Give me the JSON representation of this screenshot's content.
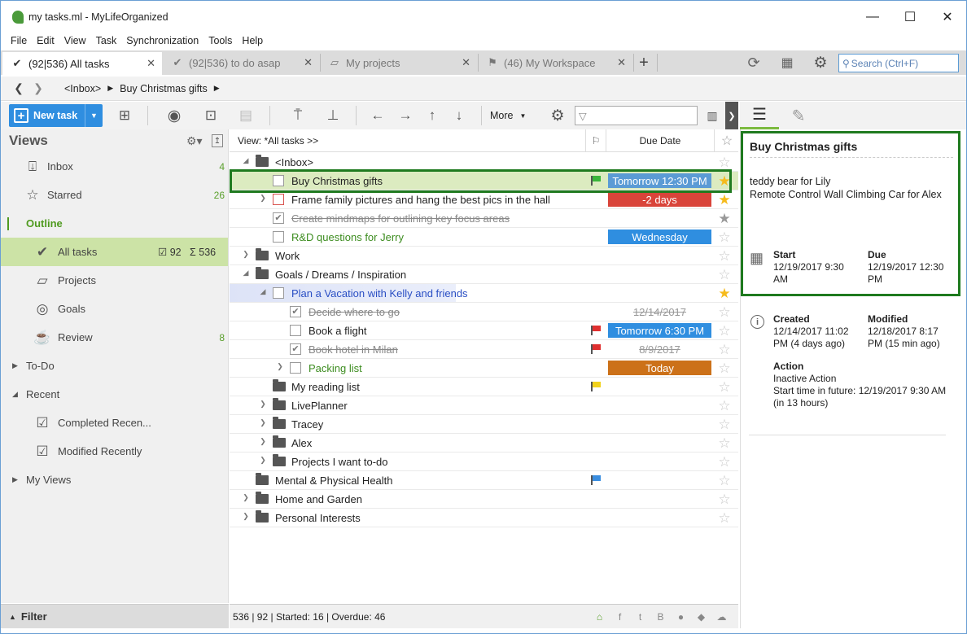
{
  "window": {
    "title": "my tasks.ml - MyLifeOrganized",
    "controls": [
      "—",
      "☐",
      "✕"
    ]
  },
  "menu": [
    "File",
    "Edit",
    "View",
    "Task",
    "Synchronization",
    "Tools",
    "Help"
  ],
  "tabs": [
    {
      "label": "(92|536) All tasks",
      "icon": "tasks-check-icon",
      "active": true
    },
    {
      "label": "(92|536) to do asap",
      "icon": "tasks-check-icon",
      "active": false
    },
    {
      "label": "My projects",
      "icon": "projects-icon",
      "active": false
    },
    {
      "label": "(46) My Workspace",
      "icon": "workspace-flag-icon",
      "active": false
    }
  ],
  "search": {
    "placeholder": "Search (Ctrl+F)"
  },
  "breadcrumb": {
    "items": [
      "<Inbox>",
      "Buy Christmas gifts"
    ]
  },
  "toolbar": {
    "new_task": "New task",
    "more": "More"
  },
  "sidebar": {
    "title": "Views",
    "items": [
      {
        "label": "Inbox",
        "count": "4",
        "icon": "inbox-icon"
      },
      {
        "label": "Starred",
        "count": "26",
        "icon": "star-icon"
      },
      {
        "label": "Outline"
      },
      {
        "label": "All tasks",
        "check_count": "92",
        "sigma_count": "536",
        "icon": "all-tasks-icon"
      },
      {
        "label": "Projects",
        "icon": "projects-icon"
      },
      {
        "label": "Goals",
        "icon": "goals-target-icon"
      },
      {
        "label": "Review",
        "count": "8",
        "icon": "review-coffee-icon"
      },
      {
        "label": "To-Do"
      },
      {
        "label": "Recent"
      },
      {
        "label": "Completed Recen...",
        "icon": "completed-icon"
      },
      {
        "label": "Modified Recently",
        "icon": "modified-icon"
      },
      {
        "label": "My Views"
      }
    ],
    "footer": "Filter"
  },
  "tasklist": {
    "view_label": "View: *All tasks >>",
    "due_header": "Due Date",
    "rows": [
      {
        "text": "<Inbox>",
        "due": ""
      },
      {
        "text": "Buy Christmas gifts",
        "due": "Tomorrow 12:30 PM"
      },
      {
        "text": "Frame family pictures and hang the best pics in the hall",
        "due": "-2 days"
      },
      {
        "text": "Create mindmaps for outlining key focus areas",
        "due": ""
      },
      {
        "text": "R&D questions for Jerry",
        "due": "Wednesday"
      },
      {
        "text": "Work",
        "due": ""
      },
      {
        "text": "Goals / Dreams / Inspiration",
        "due": ""
      },
      {
        "text": "Plan a Vacation with Kelly and friends",
        "due": ""
      },
      {
        "text": "Decide where to go",
        "due": "12/14/2017"
      },
      {
        "text": "Book a flight",
        "due": "Tomorrow 6:30 PM"
      },
      {
        "text": "Book hotel in Milan",
        "due": "8/9/2017"
      },
      {
        "text": "Packing list",
        "due": "Today"
      },
      {
        "text": "My reading list",
        "due": ""
      },
      {
        "text": "LivePlanner",
        "due": ""
      },
      {
        "text": "Tracey",
        "due": ""
      },
      {
        "text": "Alex",
        "due": ""
      },
      {
        "text": "Projects I want to-do",
        "due": ""
      },
      {
        "text": "Mental & Physical Health",
        "due": ""
      },
      {
        "text": "Home and Garden",
        "due": ""
      },
      {
        "text": "Personal Interests",
        "due": ""
      }
    ],
    "status": "536 | 92 | Started: 16 | Overdue: 46"
  },
  "colors": {
    "due_blue": "#2f8ee0",
    "due_red": "#d9443a",
    "due_orange": "#cc7119",
    "flag_green": "#3ab53a",
    "flag_red": "#e03030",
    "flag_yellow": "#f2d21b",
    "flag_blue": "#3a8ee0",
    "accent_green": "#1f7a1f"
  },
  "details": {
    "title": "Buy Christmas gifts",
    "note_line1": "teddy bear for Lily",
    "note_line2": "Remote Control Wall Climbing Car for Alex",
    "start_label": "Start",
    "start_value1": "12/19/2017 9:30",
    "start_value2": "AM",
    "due_label": "Due",
    "due_value1": "12/19/2017 12:30",
    "due_value2": "PM",
    "created_label": "Created",
    "created_value1": "12/14/2017 11:02",
    "created_value2": "PM (4 days ago)",
    "modified_label": "Modified",
    "modified_value1": "12/18/2017 8:17",
    "modified_value2": "PM (15 min ago)",
    "action_label": "Action",
    "action_value1": "Inactive Action",
    "action_value2": "Start time in future: 12/19/2017 9:30 AM",
    "action_value3": "(in 13 hours)"
  }
}
